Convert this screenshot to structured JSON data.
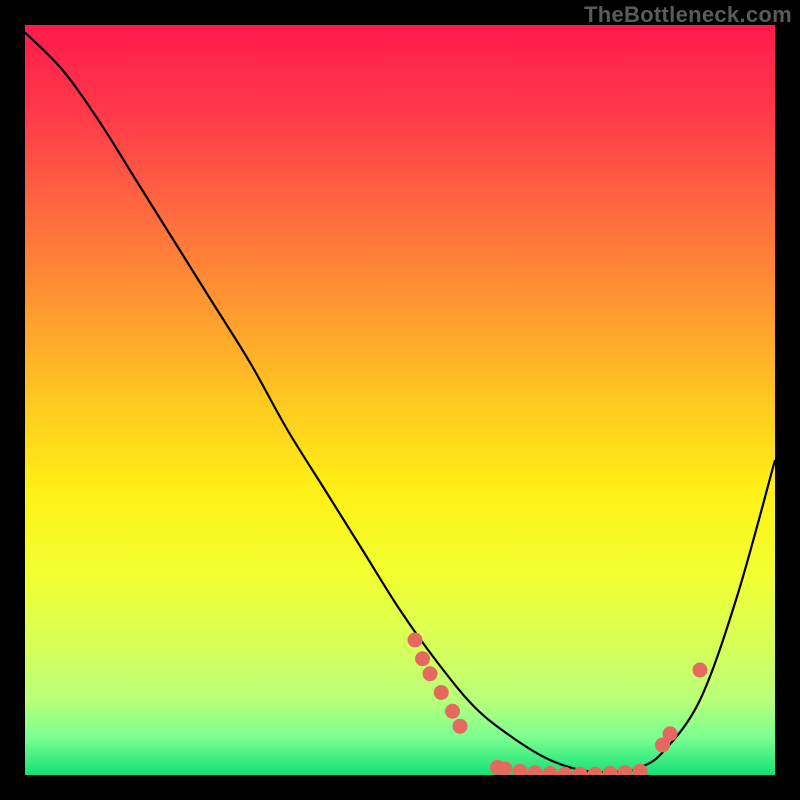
{
  "watermark": "TheBottleneck.com",
  "chart_data": {
    "type": "line",
    "title": "",
    "xlabel": "",
    "ylabel": "",
    "xlim": [
      0,
      100
    ],
    "ylim": [
      0,
      100
    ],
    "grid": false,
    "series": [
      {
        "name": "curve",
        "x": [
          0,
          5,
          10,
          15,
          20,
          25,
          30,
          35,
          40,
          45,
          50,
          55,
          60,
          65,
          70,
          75,
          80,
          82,
          85,
          90,
          95,
          100
        ],
        "y": [
          99,
          94,
          87,
          79,
          71,
          63,
          55,
          46,
          38,
          30,
          22,
          15,
          9,
          5,
          2,
          0.5,
          0.5,
          1,
          3,
          10,
          24,
          42
        ]
      }
    ],
    "markers": [
      {
        "x": 52,
        "y": 18
      },
      {
        "x": 53,
        "y": 15.5
      },
      {
        "x": 54,
        "y": 13.5
      },
      {
        "x": 55.5,
        "y": 11
      },
      {
        "x": 57,
        "y": 8.5
      },
      {
        "x": 58,
        "y": 6.5
      },
      {
        "x": 63,
        "y": 1.0
      },
      {
        "x": 64,
        "y": 0.8
      },
      {
        "x": 66,
        "y": 0.5
      },
      {
        "x": 68,
        "y": 0.3
      },
      {
        "x": 70,
        "y": 0.2
      },
      {
        "x": 72,
        "y": 0.1
      },
      {
        "x": 74,
        "y": 0.1
      },
      {
        "x": 76,
        "y": 0.1
      },
      {
        "x": 78,
        "y": 0.2
      },
      {
        "x": 80,
        "y": 0.3
      },
      {
        "x": 82,
        "y": 0.5
      },
      {
        "x": 85,
        "y": 4.0
      },
      {
        "x": 86,
        "y": 5.5
      },
      {
        "x": 90,
        "y": 14.0
      }
    ],
    "gradient_stops": [
      {
        "offset": 0,
        "color": "#ff1a4d"
      },
      {
        "offset": 12,
        "color": "#ff3a4a"
      },
      {
        "offset": 25,
        "color": "#ff6a3f"
      },
      {
        "offset": 38,
        "color": "#ff9a30"
      },
      {
        "offset": 50,
        "color": "#ffc820"
      },
      {
        "offset": 62,
        "color": "#fff015"
      },
      {
        "offset": 73,
        "color": "#f2ff30"
      },
      {
        "offset": 83,
        "color": "#d6ff5a"
      },
      {
        "offset": 90,
        "color": "#b8ff7a"
      },
      {
        "offset": 95,
        "color": "#7aff90"
      },
      {
        "offset": 100,
        "color": "#14e076"
      }
    ],
    "marker_color": "#e4695e",
    "curve_color": "#000000"
  }
}
